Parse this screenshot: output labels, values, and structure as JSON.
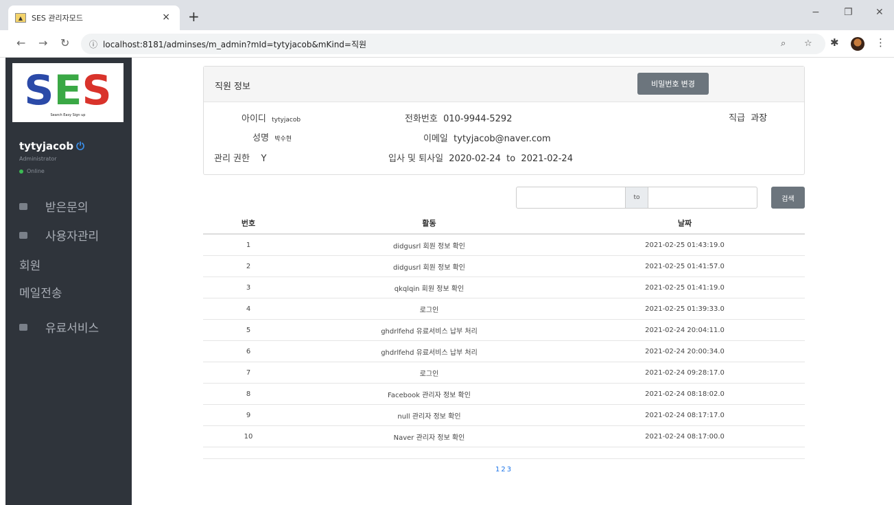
{
  "browser": {
    "tab_title": "SES 관리자모드",
    "tab_close": "×",
    "new_tab": "+",
    "url": "localhost:8181/adminses/m_admin?mId=tytyjacob&mKind=직원",
    "window_controls": [
      "−",
      "❐",
      "✕"
    ]
  },
  "sidebar": {
    "logo_text": [
      "S",
      "E",
      "S"
    ],
    "logo_tagline": "Search Easy Sign up",
    "user_name": "tytyjacob",
    "user_role": "Administrator",
    "user_status": "Online",
    "menu": [
      {
        "label": "받은문의",
        "icon": "chat-icon"
      },
      {
        "label": "사용자관리",
        "icon": "user-icon"
      },
      {
        "label": "회원",
        "icon": ""
      },
      {
        "label": "메일전송",
        "icon": ""
      },
      {
        "label": "유료서비스",
        "icon": "card-icon"
      }
    ]
  },
  "card": {
    "title": "직원 정보",
    "password_button": "비밀번호 변경",
    "fields": {
      "id_label": "아이디",
      "id_value": "tytyjacob",
      "name_label": "성명",
      "name_value": "박수현",
      "auth_label": "관리 권한",
      "auth_value": "Y",
      "phone_label": "전화번호",
      "phone_value": "010-9944-5292",
      "email_label": "이메일",
      "email_value": "tytyjacob@naver.com",
      "period_label": "입사 및 퇴사일",
      "period_value": "2020-02-24  to  2021-02-24",
      "rank_label": "직급",
      "rank_value": "과장"
    }
  },
  "search": {
    "to_label": "to",
    "button": "검색"
  },
  "table": {
    "headers": [
      "번호",
      "활동",
      "날짜"
    ],
    "rows": [
      {
        "no": "1",
        "activity": "didgusrl 회원 정보 확인",
        "date": "2021-02-25 01:43:19.0"
      },
      {
        "no": "2",
        "activity": "didgusrl 회원 정보 확인",
        "date": "2021-02-25 01:41:57.0"
      },
      {
        "no": "3",
        "activity": "qkqlqin 회원 정보 확인",
        "date": "2021-02-25 01:41:19.0"
      },
      {
        "no": "4",
        "activity": "로그인",
        "date": "2021-02-25 01:39:33.0"
      },
      {
        "no": "5",
        "activity": "ghdrlfehd 유료서비스 납부 처리",
        "date": "2021-02-24 20:04:11.0"
      },
      {
        "no": "6",
        "activity": "ghdrlfehd 유료서비스 납부 처리",
        "date": "2021-02-24 20:00:34.0"
      },
      {
        "no": "7",
        "activity": "로그인",
        "date": "2021-02-24 09:28:17.0"
      },
      {
        "no": "8",
        "activity": "Facebook 관리자 정보 확인",
        "date": "2021-02-24 08:18:02.0"
      },
      {
        "no": "9",
        "activity": "null 관리자 정보 확인",
        "date": "2021-02-24 08:17:17.0"
      },
      {
        "no": "10",
        "activity": "Naver 관리자 정보 확인",
        "date": "2021-02-24 08:17:00.0"
      }
    ]
  },
  "pagination": [
    "1",
    "2",
    "3"
  ]
}
